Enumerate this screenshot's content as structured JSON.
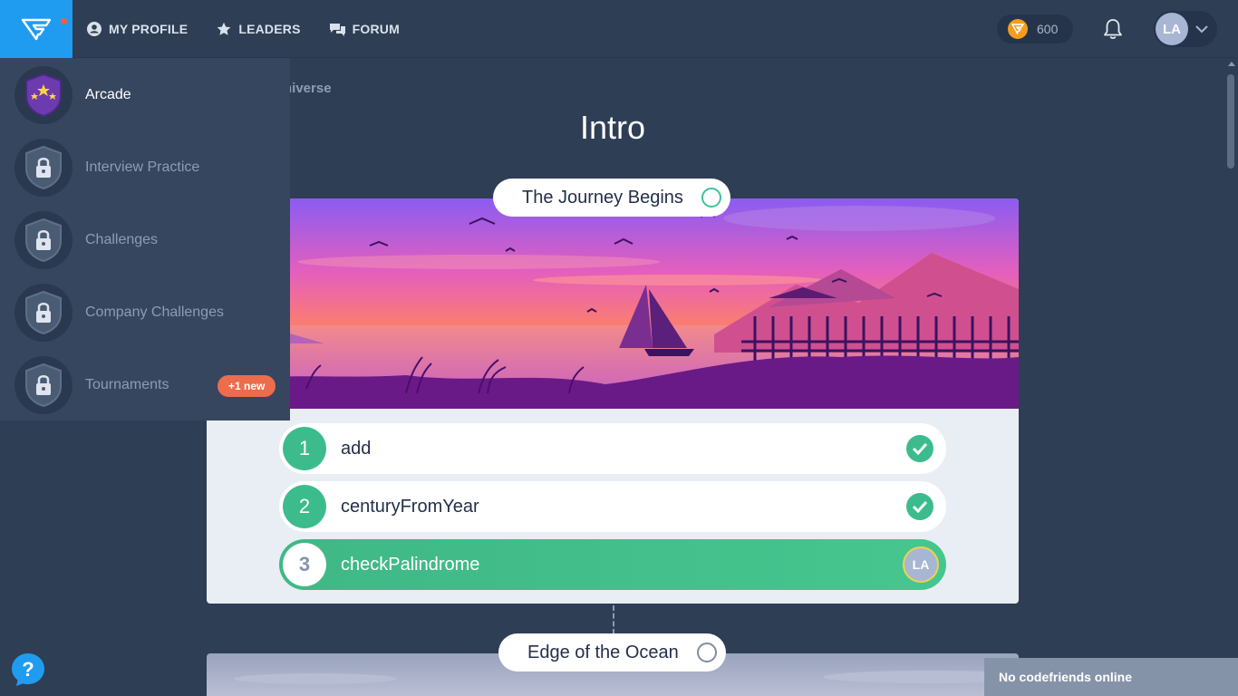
{
  "nav": {
    "profile": "MY PROFILE",
    "leaders": "LEADERS",
    "forum": "FORUM"
  },
  "coins": "600",
  "user_initials": "LA",
  "breadcrumb": "niverse",
  "page_title": "Intro",
  "menu": {
    "items": [
      {
        "label": "Arcade",
        "icon": "arcade-shield-icon",
        "locked": false
      },
      {
        "label": "Interview Practice",
        "icon": "lock-shield-icon",
        "locked": true
      },
      {
        "label": "Challenges",
        "icon": "lock-shield-icon",
        "locked": true
      },
      {
        "label": "Company Challenges",
        "icon": "lock-shield-icon",
        "locked": true
      },
      {
        "label": "Tournaments",
        "icon": "lock-shield-icon",
        "locked": true
      }
    ],
    "tournaments_badge": "+1 new"
  },
  "levels": [
    {
      "title": "The Journey Begins",
      "tasks": [
        {
          "num": "1",
          "name": "add",
          "status": "done"
        },
        {
          "num": "2",
          "name": "centuryFromYear",
          "status": "done"
        },
        {
          "num": "3",
          "name": "checkPalindrome",
          "status": "current"
        }
      ]
    },
    {
      "title": "Edge of the Ocean"
    }
  ],
  "friends_status": "No codefriends online",
  "colors": {
    "accent_blue": "#1f9cf0",
    "success_green": "#3cbc8d",
    "background": "#2e3e55",
    "badge_orange": "#ec6c4c"
  }
}
